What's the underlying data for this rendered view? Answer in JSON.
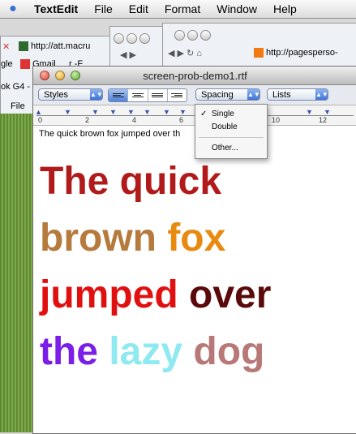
{
  "menubar": {
    "app": "TextEdit",
    "items": [
      "File",
      "Edit",
      "Format",
      "Window",
      "Help"
    ]
  },
  "background": {
    "url_1": "http://att.macru",
    "url_2": "http://pagesperso-",
    "bookmark_gle": "gle",
    "bookmark_gmail": "Gmail",
    "bookmark_3": "r -F",
    "bookmark_4": "ok G4 -",
    "file_label": "File"
  },
  "window": {
    "title": "screen-prob-demo1.rtf",
    "styles_label": "Styles",
    "spacing_label": "Spacing",
    "lists_label": "Lists"
  },
  "ruler": {
    "numbers": [
      "0",
      "2",
      "4",
      "6",
      "10",
      "12"
    ]
  },
  "spacing_menu": {
    "checked": "✓",
    "options": [
      "Single",
      "Double",
      "Other..."
    ]
  },
  "document": {
    "small_line": "The quick brown fox jumped over th",
    "big_lines": [
      [
        {
          "text": "The quick",
          "color": "#b11a1a"
        }
      ],
      [
        {
          "text": "brown ",
          "color": "#b57a3c"
        },
        {
          "text": "fox",
          "color": "#e88a10"
        }
      ],
      [
        {
          "text": "jumped ",
          "color": "#e01010"
        },
        {
          "text": "over",
          "color": "#5a0a0a"
        }
      ],
      [
        {
          "text": "the ",
          "color": "#7a1ee8"
        },
        {
          "text": "lazy ",
          "color": "#8eeaf0"
        },
        {
          "text": "dog",
          "color": "#b87878"
        }
      ]
    ]
  }
}
